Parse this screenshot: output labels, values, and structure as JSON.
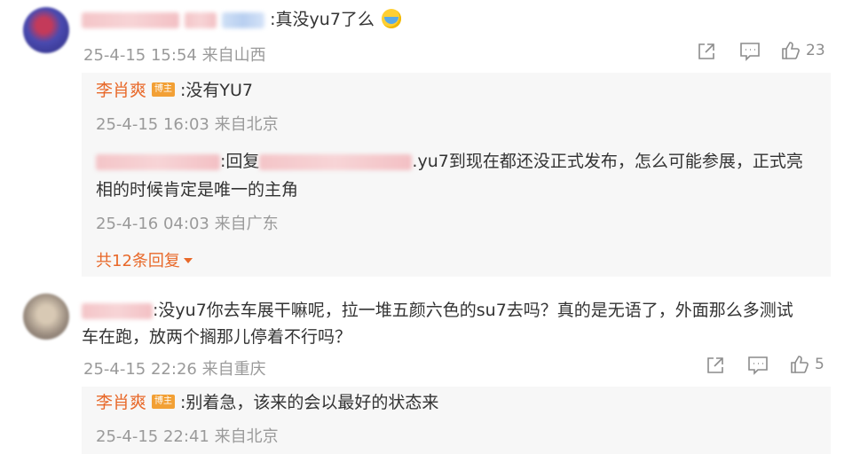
{
  "comments": [
    {
      "text": ":真没yu7了么",
      "emoji": "crying-laughing-emoji",
      "meta": "25-4-15 15:54 来自山西",
      "likes": "23",
      "replies": [
        {
          "author": "李肖爽",
          "badge": "博主",
          "text": ":没有YU7",
          "meta": "25-4-15 16:03 来自北京"
        },
        {
          "reply_prefix": ":回复",
          "text_line1": ".yu7到现在都还没正式发布，怎么可能参展，正式亮",
          "text_line2": "相的时候肯定是唯一的主角",
          "meta": "25-4-16 04:03 来自广东"
        }
      ],
      "more_replies": "共12条回复"
    },
    {
      "text_line1": ":没yu7你去车展干嘛呢，拉一堆五颜六色的su7去吗？真的是无语了，外面那么多测试",
      "text_line2": "车在跑，放两个搁那儿停着不行吗？",
      "meta": "25-4-15 22:26 来自重庆",
      "likes": "5",
      "replies": [
        {
          "author": "李肖爽",
          "badge": "博主",
          "text": ":别着急，该来的会以最好的状态来",
          "meta": "25-4-15 22:41 来自北京"
        }
      ]
    }
  ],
  "icons": {
    "share": "share-icon",
    "comment": "comment-icon",
    "like": "like-icon"
  },
  "colors": {
    "author": "#e8692a",
    "badge": "#f2a035",
    "meta": "#9a9a9a",
    "reply_bg": "#f7f7f7"
  }
}
